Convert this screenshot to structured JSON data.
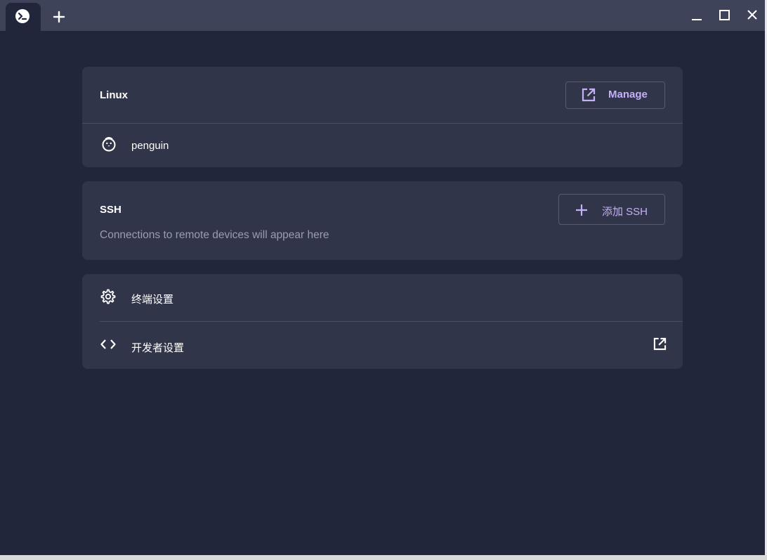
{
  "titlebar": {
    "tab_icon": "terminal-prompt-icon",
    "new_tab_icon": "plus-icon",
    "window_controls": [
      "minimize-icon",
      "maximize-icon",
      "close-icon"
    ]
  },
  "linux": {
    "title": "Linux",
    "manage_label": "Manage",
    "manage_icon": "open-in-new-icon",
    "containers": [
      {
        "name": "penguin",
        "icon": "penguin-icon"
      }
    ]
  },
  "ssh": {
    "title": "SSH",
    "add_label": "添加 SSH",
    "add_icon": "plus-icon",
    "empty_text": "Connections to remote devices will appear here"
  },
  "settings": {
    "items": [
      {
        "label": "终端设置",
        "icon": "gear-icon"
      },
      {
        "label": "开发者设置",
        "icon": "code-icon",
        "trailing_icon": "open-in-new-icon"
      }
    ]
  },
  "colors": {
    "background": "#21263b",
    "card": "#313549",
    "titlebar": "#3e435a",
    "accent": "#c4b0f7"
  }
}
